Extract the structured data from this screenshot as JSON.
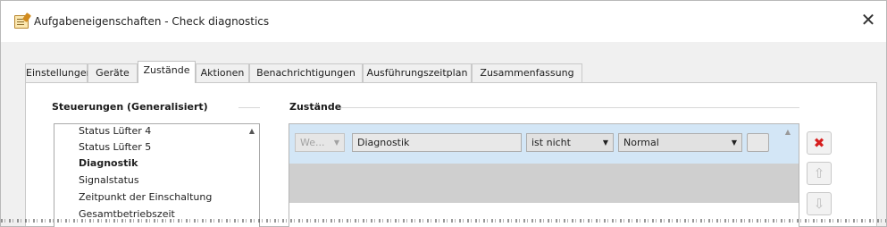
{
  "window": {
    "title": "Aufgabeneigenschaften - Check diagnostics",
    "icon": "task-properties-icon",
    "close_glyph": "✕"
  },
  "tabs": [
    {
      "label": "Einstellungen",
      "active": false
    },
    {
      "label": "Geräte",
      "active": false
    },
    {
      "label": "Zustände",
      "active": true
    },
    {
      "label": "Aktionen",
      "active": false
    },
    {
      "label": "Benachrichtigungen",
      "active": false
    },
    {
      "label": "Ausführungszeitplan",
      "active": false
    },
    {
      "label": "Zusammenfassung",
      "active": false
    }
  ],
  "controls_group": {
    "label": "Steuerungen (Generalisiert)",
    "items": [
      {
        "label": "Status Lüfter 4",
        "bold": false
      },
      {
        "label": "Status Lüfter 5",
        "bold": false
      },
      {
        "label": "Diagnostik",
        "bold": true
      },
      {
        "label": "Signalstatus",
        "bold": false
      },
      {
        "label": "Zeitpunkt der Einschaltung",
        "bold": false
      },
      {
        "label": "Gesamtbetriebszeit",
        "bold": false
      }
    ]
  },
  "states_group": {
    "label": "Zustände",
    "row": {
      "logic": "We...",
      "control": "Diagnostik",
      "operator": "ist nicht",
      "value": "Normal"
    }
  },
  "side_buttons": {
    "delete_icon": "delete-icon",
    "up_icon": "move-up-icon",
    "down_icon": "move-down-icon"
  },
  "colors": {
    "selected_row": "#d3e6f6",
    "delete_red": "#d61e1e"
  }
}
